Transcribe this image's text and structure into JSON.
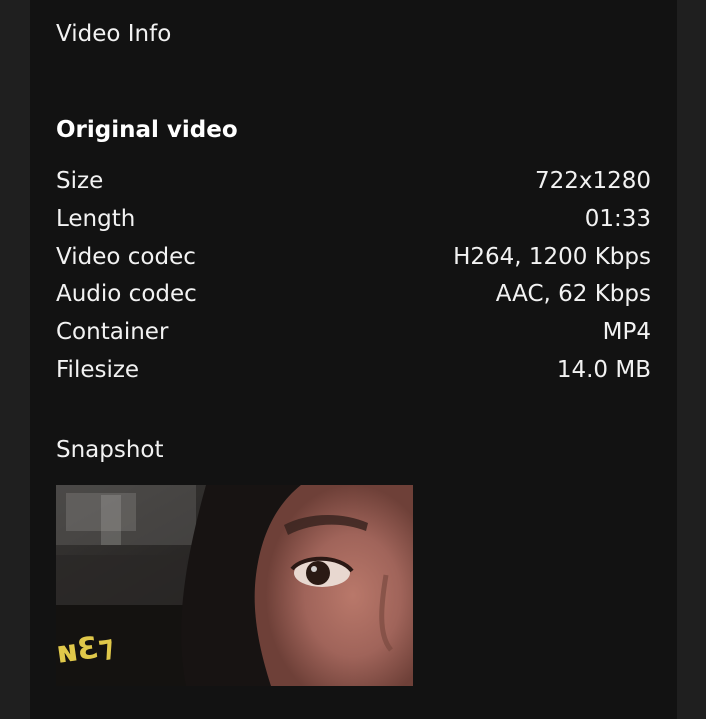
{
  "panel": {
    "title": "Video Info"
  },
  "original_video": {
    "heading": "Original video",
    "rows": [
      {
        "label": "Size",
        "value": "722x1280"
      },
      {
        "label": "Length",
        "value": "01:33"
      },
      {
        "label": "Video codec",
        "value": "H264, 1200 Kbps"
      },
      {
        "label": "Audio codec",
        "value": "AAC, 62 Kbps"
      },
      {
        "label": "Container",
        "value": "MP4"
      },
      {
        "label": "Filesize",
        "value": "14.0 MB"
      }
    ]
  },
  "snapshot": {
    "heading": "Snapshot"
  }
}
